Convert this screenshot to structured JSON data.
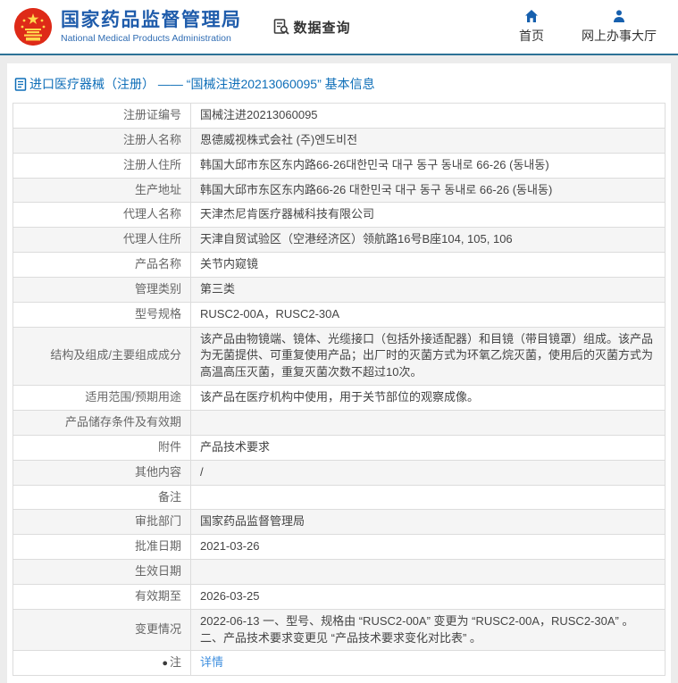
{
  "header": {
    "brand": {
      "title_cn": "国家药品监督管理局",
      "title_en": "National Medical Products Administration"
    },
    "data_query_label": "数据查询",
    "nav": [
      {
        "label": "首页",
        "icon": "home-icon"
      },
      {
        "label": "网上办事大厅",
        "icon": "user-icon"
      }
    ]
  },
  "breadcrumb": {
    "text": "进口医疗器械（注册） —— “国械注进20213060095” 基本信息"
  },
  "colors": {
    "brand_blue": "#1f5cab",
    "breadcrumb_blue": "#0e6eb8",
    "link_blue": "#3f8fdf",
    "header_rule": "#2d7296",
    "emblem_red": "#de2a18",
    "alt_row_bg": "#f5f5f5"
  },
  "table": {
    "rows": [
      {
        "label": "注册证编号",
        "value": "国械注进20213060095"
      },
      {
        "label": "注册人名称",
        "value": "恩德威视株式会社 (주)엔도비전"
      },
      {
        "label": "注册人住所",
        "value": "韩国大邱市东区东内路66-26대한민국 대구 동구 동내로 66-26 (동내동)"
      },
      {
        "label": "生产地址",
        "value": "韩国大邱市东区东内路66-26 대한민국 대구 동구 동내로 66-26 (동내동)"
      },
      {
        "label": "代理人名称",
        "value": "天津杰尼肯医疗器械科技有限公司"
      },
      {
        "label": "代理人住所",
        "value": "天津自贸试验区（空港经济区）领航路16号B座104, 105, 106"
      },
      {
        "label": "产品名称",
        "value": "关节内窥镜"
      },
      {
        "label": "管理类别",
        "value": "第三类"
      },
      {
        "label": "型号规格",
        "value": "RUSC2-00A，RUSC2-30A"
      },
      {
        "label": "结构及组成/主要组成成分",
        "value": "该产品由物镜端、镜体、光缆接口（包括外接适配器）和目镜（带目镜罩）组成。该产品为无菌提供、可重复使用产品；出厂时的灭菌方式为环氧乙烷灭菌，使用后的灭菌方式为高温高压灭菌，重复灭菌次数不超过10次。"
      },
      {
        "label": "适用范围/预期用途",
        "value": "该产品在医疗机构中使用，用于关节部位的观察成像。"
      },
      {
        "label": "产品储存条件及有效期",
        "value": ""
      },
      {
        "label": "附件",
        "value": "产品技术要求"
      },
      {
        "label": "其他内容",
        "value": "/"
      },
      {
        "label": "备注",
        "value": ""
      },
      {
        "label": "审批部门",
        "value": "国家药品监督管理局"
      },
      {
        "label": "批准日期",
        "value": "2021-03-26"
      },
      {
        "label": "生效日期",
        "value": ""
      },
      {
        "label": "有效期至",
        "value": "2026-03-25"
      },
      {
        "label": "变更情况",
        "value": "2022-06-13 一、型号、规格由 “RUSC2-00A” 变更为 “RUSC2-00A，RUSC2-30A” 。二、产品技术要求变更见 “产品技术要求变化对比表” 。"
      },
      {
        "label": "注",
        "value": "详情",
        "link": true,
        "label_icon": "note"
      }
    ]
  }
}
